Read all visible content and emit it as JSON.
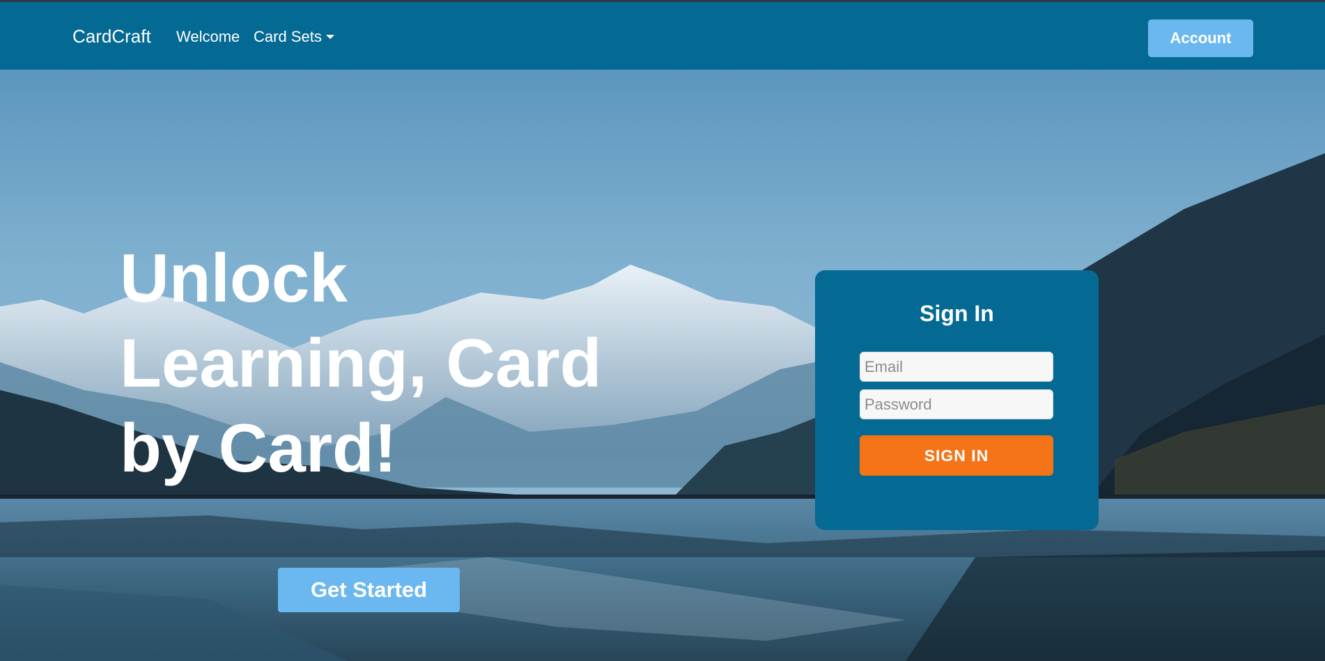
{
  "navbar": {
    "brand": "CardCraft",
    "links": [
      "Welcome",
      "Card Sets"
    ],
    "account_label": "Account"
  },
  "hero": {
    "headline": "Unlock Learning, Card by Card!",
    "cta_label": "Get Started"
  },
  "signin": {
    "title": "Sign In",
    "email_placeholder": "Email",
    "password_placeholder": "Password",
    "button_label": "SIGN IN"
  },
  "colors": {
    "navbar_bg": "#046a94",
    "accent_light_blue": "#6ab8ef",
    "signin_button": "#f57418"
  },
  "icons": {
    "card_sets_dropdown": "caret-down-icon"
  }
}
